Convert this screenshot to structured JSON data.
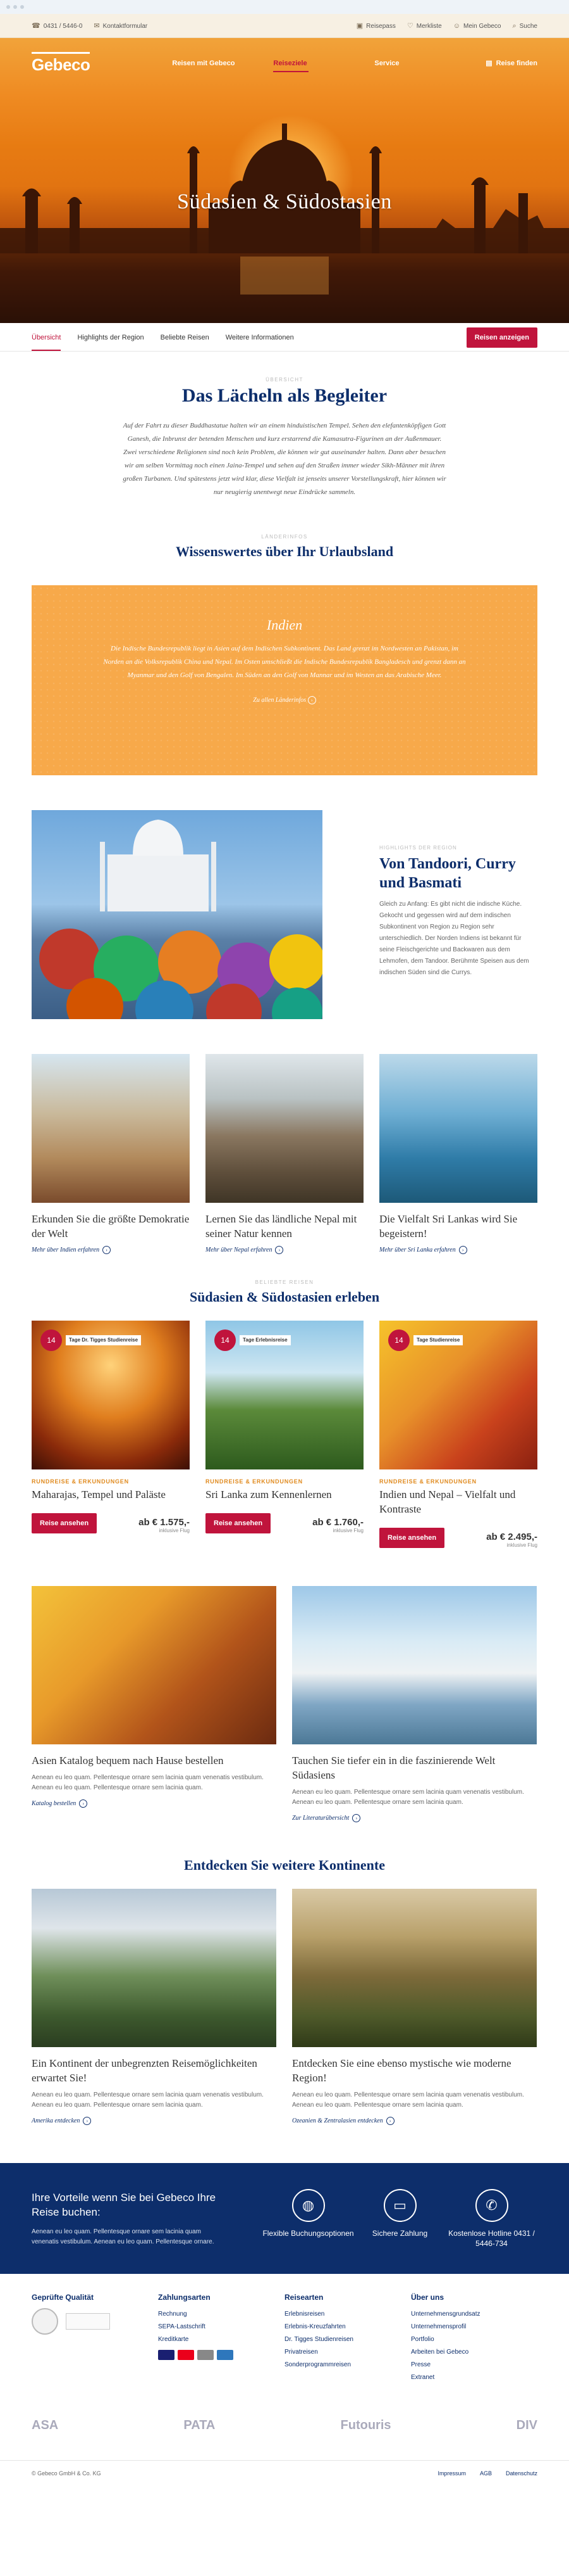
{
  "topbar": {
    "phone": "0431 / 5446-0",
    "newsletter": "Kontaktformular",
    "items": [
      "Reisepass",
      "Merkliste",
      "Mein Gebeco",
      "Suche"
    ]
  },
  "nav": {
    "logo": "Gebeco",
    "menu": [
      "Reisen mit Gebeco",
      "Reiseziele",
      "Service"
    ],
    "finder": "Reise finden"
  },
  "hero": {
    "title": "Südasien & Südostasien"
  },
  "subnav": {
    "items": [
      "Übersicht",
      "Highlights der Region",
      "Beliebte Reisen",
      "Weitere Informationen"
    ],
    "button": "Reisen anzeigen"
  },
  "intro": {
    "eyebrow": "Übersicht",
    "title": "Das Lächeln als Begleiter",
    "text": "Auf der Fahrt zu dieser Buddhastatue halten wir an einem hinduistischen Tempel. Sehen den elefantenköpfigen Gott Ganesh, die Inbrunst der betenden Menschen und kurz erstarrend die Kamasutra-Figurinen an der Außenmauer. Zwei verschiedene Religionen sind noch kein Problem, die können wir gut auseinander halten. Dann aber besuchen wir am selben Vormittag noch einen Jaina-Tempel und sehen auf den Straßen immer wieder Sikh-Männer mit ihren großen Turbanen. Und spätestens jetzt wird klar, diese Vielfalt ist jenseits unserer Vorstellungskraft, hier können wir nur neugierig unentwegt neue Eindrücke sammeln."
  },
  "wissen": {
    "eyebrow": "Länderinfos",
    "title": "Wissenswertes über Ihr Urlaubsland",
    "box_title": "Indien",
    "box_text": "Die Indische Bundesrepublik liegt in Asien auf dem Indischen Subkontinent. Das Land grenzt im Nordwesten an Pakistan, im Norden an die Volksrepublik China und Nepal. Im Osten umschließt die Indische Bundesrepublik Bangladesch und grenzt dann an Myanmar und den Golf von Bengalen. Im Süden an den Golf von Mannar und im Westen an das Arabische Meer.",
    "box_link": "Zu allen Länderinfos"
  },
  "feature": {
    "eyebrow": "Highlights der Region",
    "title": "Von Tandoori, Curry und Basmati",
    "text": "Gleich zu Anfang: Es gibt nicht die indische Küche. Gekocht und gegessen wird auf dem indischen Subkontinent von Region zu Region sehr unterschiedlich. Der Norden Indiens ist bekannt für seine Fleischgerichte und Backwaren aus dem Lehmofen, dem Tandoor. Berühmte Speisen aus dem indischen Süden sind die Currys."
  },
  "highlights": [
    {
      "title": "Erkunden Sie die größte Demokratie der Welt",
      "link": "Mehr über Indien erfahren"
    },
    {
      "title": "Lernen Sie das ländliche Nepal mit seiner Natur kennen",
      "link": "Mehr über Nepal erfahren"
    },
    {
      "title": "Die Vielfalt Sri Lankas wird Sie begeistern!",
      "link": "Mehr über Sri Lanka erfahren"
    }
  ],
  "tours_section": {
    "eyebrow": "Beliebte Reisen",
    "title": "Südasien & Südostasien erleben"
  },
  "tours": [
    {
      "days": "14",
      "label": "Tage Dr. Tigges Studienreise",
      "category": "RUNDREISE & ERKUNDUNGEN",
      "title": "Maharajas, Tempel und Paläste",
      "button": "Reise ansehen",
      "price": "ab € 1.575,-",
      "price_note": "inklusive Flug"
    },
    {
      "days": "14",
      "label": "Tage Erlebnisreise",
      "category": "RUNDREISE & ERKUNDUNGEN",
      "title": "Sri Lanka zum Kennenlernen",
      "button": "Reise ansehen",
      "price": "ab € 1.760,-",
      "price_note": "inklusive Flug"
    },
    {
      "days": "14",
      "label": "Tage Studienreise",
      "category": "RUNDREISE & ERKUNDUNGEN",
      "title": "Indien und Nepal – Vielfalt und Kontraste",
      "button": "Reise ansehen",
      "price": "ab € 2.495,-",
      "price_note": "inklusive Flug"
    }
  ],
  "catalog": [
    {
      "title": "Asien Katalog bequem nach Hause bestellen",
      "text": "Aenean eu leo quam. Pellentesque ornare sem lacinia quam venenatis vestibulum. Aenean eu leo quam. Pellentesque ornare sem lacinia quam.",
      "link": "Katalog bestellen"
    },
    {
      "title": "Tauchen Sie tiefer ein in die faszinierende Welt Südasiens",
      "text": "Aenean eu leo quam. Pellentesque ornare sem lacinia quam venenatis vestibulum. Aenean eu leo quam. Pellentesque ornare sem lacinia quam.",
      "link": "Zur Literaturübersicht"
    }
  ],
  "continents": {
    "title": "Entdecken Sie weitere Kontinente",
    "items": [
      {
        "title": "Ein Kontinent der unbegrenzten Reisemöglichkeiten erwartet Sie!",
        "text": "Aenean eu leo quam. Pellentesque ornare sem lacinia quam venenatis vestibulum. Aenean eu leo quam. Pellentesque ornare sem lacinia quam.",
        "link": "Amerika entdecken"
      },
      {
        "title": "Entdecken Sie eine ebenso mystische wie moderne Region!",
        "text": "Aenean eu leo quam. Pellentesque ornare sem lacinia quam venenatis vestibulum. Aenean eu leo quam. Pellentesque ornare sem lacinia quam.",
        "link": "Ozeanien & Zentralasien entdecken"
      }
    ]
  },
  "benefits": {
    "title": "Ihre Vorteile wenn Sie bei Gebeco Ihre Reise buchen:",
    "text": "Aenean eu leo quam. Pellentesque ornare sem lacinia quam venenatis vestibulum. Aenean eu leo quam. Pellentesque ornare.",
    "items": [
      {
        "icon": "globe-icon",
        "label": "Flexible Buchungsoptionen"
      },
      {
        "icon": "card-icon",
        "label": "Sichere Zahlung"
      },
      {
        "icon": "phone-icon",
        "label": "Kostenlose Hotline 0431 / 5446-734"
      }
    ]
  },
  "footer": {
    "quality": {
      "title": "Geprüfte Qualität"
    },
    "payment": {
      "title": "Zahlungsarten",
      "items": [
        "Rechnung",
        "SEPA-Lastschrift",
        "Kreditkarte"
      ]
    },
    "travel": {
      "title": "Reisearten",
      "items": [
        "Erlebnisreisen",
        "Erlebnis-Kreuzfahrten",
        "Dr. Tigges Studienreisen",
        "Privatreisen",
        "Sonderprogrammreisen"
      ]
    },
    "about": {
      "title": "Über uns",
      "items": [
        "Unternehmensgrundsatz",
        "Unternehmensprofil",
        "Portfolio",
        "Arbeiten bei Gebeco",
        "Presse",
        "Extranet"
      ]
    },
    "partners": [
      "ASA",
      "PATA",
      "Futouris",
      "DIV"
    ],
    "copyright": "© Gebeco GmbH & Co. KG",
    "links": [
      "Impressum",
      "AGB",
      "Datenschutz"
    ]
  }
}
